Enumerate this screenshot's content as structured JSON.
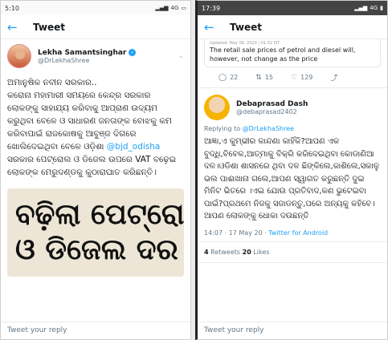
{
  "left": {
    "status": {
      "time": "5:10",
      "network": "4G"
    },
    "header": {
      "title": "Tweet"
    },
    "author": {
      "name": "Lekha Samantsinghar",
      "handle": "@DrLekhaShree"
    },
    "tweet": {
      "line1": "ଅମାନୁଷିକ ନବୀନ ସରକାର..",
      "line2": "କରୋନା ମହାମାରୀ ସମୟରେ କେନ୍ଦ୍ର ସରକାର ଲୋକଙ୍କୁ ସାହାଯ୍ୟ କରିବାକୁ ଆପ୍ରାଣ ଉଦ୍ୟମ କରୁଥିବା ବେଳେ ଓ ସାଧାରଣ ଜନତାଙ୍କ ବୋଝକୁ କମ କରିବାପାଇଁ ରାଜକୋଷକୁ ଆବୁଞ୍ଜ ଦିଗରେ ଖୋଲିଦେଇଥିବା ବେଳେ ଓଡ଼ିଶା",
      "mention": "@bjd_odisha",
      "line3": " ସରକାର ପେଟ୍ରୋଲ ଓ ଡିଜେଲ ଉପରେ VAT ବଢ଼େଇ ଲୋକଙ୍କ ମେରୁଦଣ୍ଡକୁ କୁଠାରାଘାତ କରିଛନ୍ତି।"
    },
    "photo": {
      "line1": "ବଢ଼ିଲା ପେଟ୍ରୋଲ",
      "line2": "ଓ ଡିଜେଲ ଦର"
    },
    "reply_placeholder": "Tweet your reply"
  },
  "right": {
    "status": {
      "time": "17:39",
      "network": "4G"
    },
    "header": {
      "title": "Tweet"
    },
    "quoted": {
      "updated": "Updated: May 06, 2020 | 01:32 IST",
      "text": "The retail sale prices of petrol and diesel will, however, not change as the price"
    },
    "actions": {
      "replies": "22",
      "retweets": "15",
      "likes": "129"
    },
    "author": {
      "name": "Debaprasad Dash",
      "handle": "@debaprasad2402"
    },
    "replying": {
      "prefix": "Replying to ",
      "to": "@DrLekhaShree"
    },
    "tweet": "ଆଜ୍ଞା,ଏ କୁମ୍ଭୀର କାନ୍ଦଣା କାହିଁକି?ଆପଣ ଏକ ବୁଦ୍ଧି,ବିବେକ,ଆତ୍ମାକୁ ବିକ୍ରି କରିଦେଇଥିବା କୋଡାଣିଆ ଦଳ।ଓଡିଶା ଶାସନରେ ଥିବା ଦଳ ଛିଙ୍କିଲେ,କାଶିଲେ,ସକାଳୁ ଭଲ ପାଈଖାନା ଗଲେ,ଆପଣ ସ୍ୱାଗତ କରୁଛନ୍ତି ଦୁଇ ମିନିଟ ଭିତରେ ।ଏଇ ଯୋଉ ପ୍ରତିବାଦ,କଣ ଭୁଟେଇବା ପାଇଁ?ପ୍ରଥମେ ନିଜକୁ ସଜାଡନ୍ତୁ,ପରେ ଅନ୍ୟକୁ କହିବେ।ଆପଣ ଲୋକଙ୍କୁ ଧୋକା ଦଉଛନ୍ତି",
    "meta": {
      "time": "14:07 · 17 May 20 · ",
      "source": "Twitter for Android"
    },
    "counts": {
      "retweets_num": "4",
      "retweets_label": " Retweets  ",
      "likes_num": "20",
      "likes_label": " Likes"
    },
    "reply_placeholder": "Tweet your reply"
  }
}
